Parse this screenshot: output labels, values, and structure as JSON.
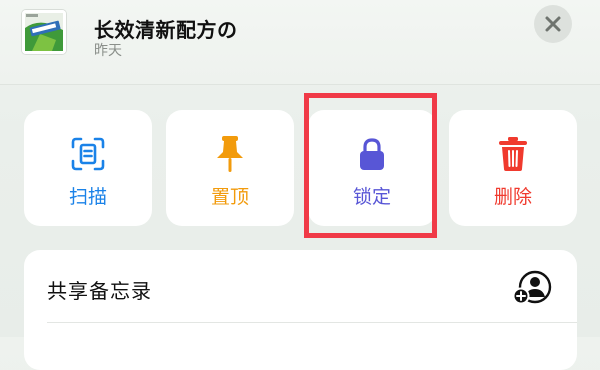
{
  "header": {
    "title": "长效清新配方の",
    "subtitle": "昨天",
    "thumbnail_icon": "gum-package-thumbnail",
    "close_icon": "close-icon"
  },
  "actions": [
    {
      "label": "扫描",
      "icon": "scan-document-icon",
      "color": "#1a82e8"
    },
    {
      "label": "置顶",
      "icon": "pin-icon",
      "color": "#f29b0c"
    },
    {
      "label": "锁定",
      "icon": "lock-icon",
      "color": "#5856d6"
    },
    {
      "label": "删除",
      "icon": "trash-icon",
      "color": "#f03a2e"
    }
  ],
  "panel": {
    "share_label": "共享备忘录",
    "share_icon": "add-person-icon"
  },
  "highlight_color": "#f03a47"
}
